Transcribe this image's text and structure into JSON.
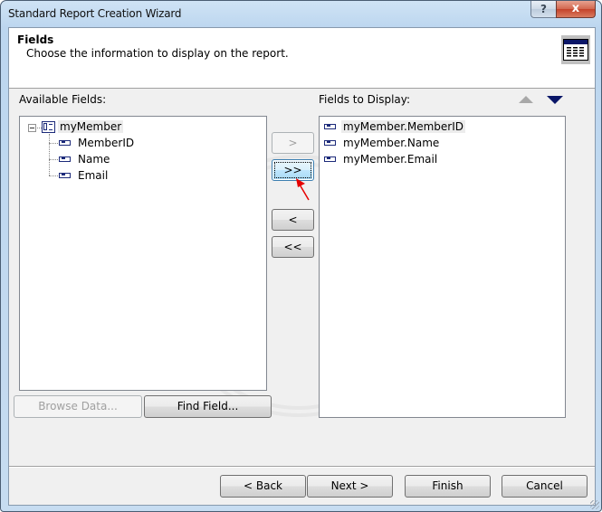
{
  "window": {
    "title": "Standard Report Creation Wizard",
    "help_button": "?",
    "close_button": "x"
  },
  "header": {
    "title": "Fields",
    "subtitle": "Choose the information to display on the report.",
    "icon": "report-table-icon"
  },
  "available_fields": {
    "label": "Available Fields:",
    "tree": {
      "root": {
        "label": "myMember",
        "icon": "table-icon",
        "expanded": true,
        "expander": "minus"
      },
      "children": [
        {
          "label": "MemberID",
          "icon": "field-icon"
        },
        {
          "label": "Name",
          "icon": "field-icon"
        },
        {
          "label": "Email",
          "icon": "field-icon"
        }
      ]
    }
  },
  "transfer_buttons": {
    "add": ">",
    "add_all": ">>",
    "remove": "<",
    "remove_all": "<<"
  },
  "fields_to_display": {
    "label": "Fields to Display:",
    "move_up_icon": "triangle-up-icon",
    "move_down_icon": "triangle-down-icon",
    "items": [
      {
        "label": "myMember.MemberID",
        "icon": "field-icon",
        "selected": true
      },
      {
        "label": "myMember.Name",
        "icon": "field-icon",
        "selected": false
      },
      {
        "label": "myMember.Email",
        "icon": "field-icon",
        "selected": false
      }
    ]
  },
  "lower_buttons": {
    "browse_data": "Browse Data...",
    "find_field": "Find Field..."
  },
  "footer": {
    "back": "< Back",
    "next": "Next >",
    "finish": "Finish",
    "cancel": "Cancel"
  },
  "colors": {
    "accent_dark_blue": "#0a1668",
    "annotation_red": "#e60000"
  }
}
